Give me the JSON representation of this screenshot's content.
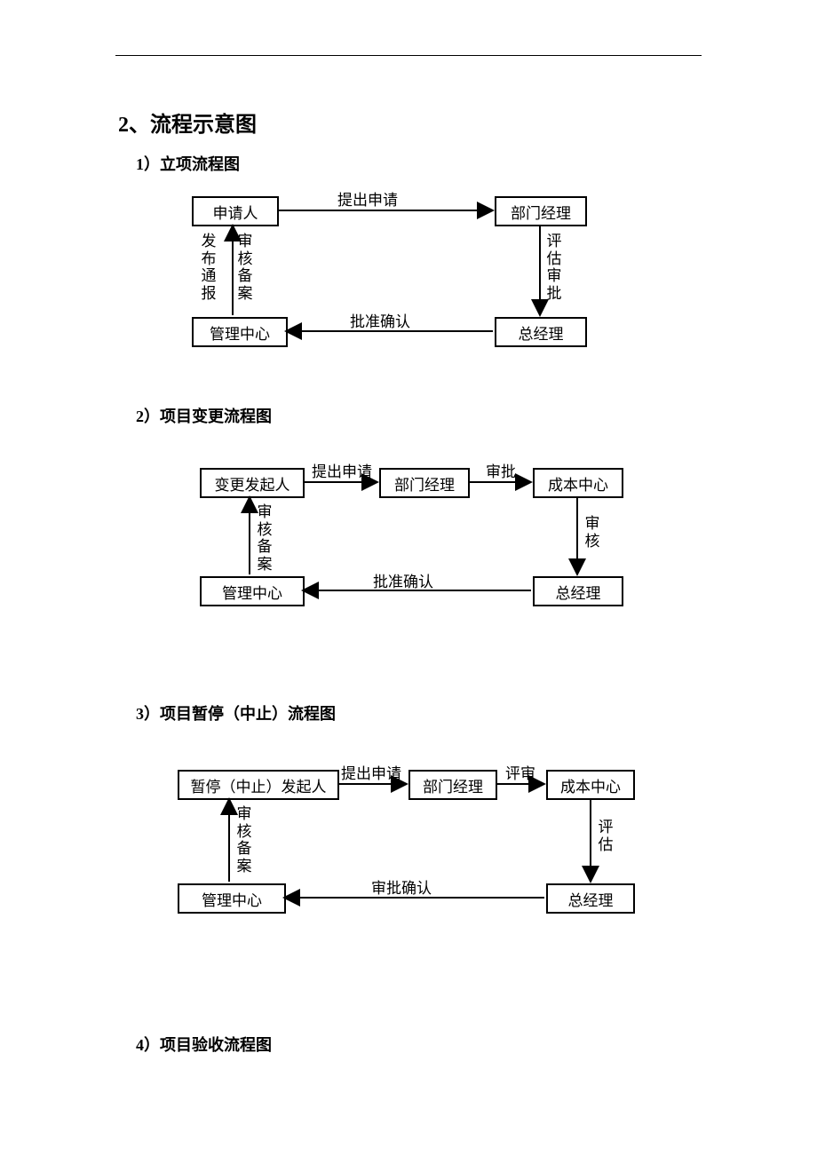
{
  "heading": "2、流程示意图",
  "section1": {
    "title": "1）立项流程图",
    "boxes": {
      "applicant": "申请人",
      "deptMgr": "部门经理",
      "gm": "总经理",
      "mgmtCenter": "管理中心"
    },
    "labels": {
      "submit": "提出申请",
      "evalApprove": "评估审批",
      "approveConfirm": "批准确认",
      "publish": "发布通报",
      "auditFile": "审核备案"
    }
  },
  "section2": {
    "title": "2）项目变更流程图",
    "boxes": {
      "initiator": "变更发起人",
      "deptMgr": "部门经理",
      "costCenter": "成本中心",
      "gm": "总经理",
      "mgmtCenter": "管理中心"
    },
    "labels": {
      "submit": "提出申请",
      "approve": "审批",
      "review": "审核",
      "approveConfirm": "批准确认",
      "auditFile": "审核备案"
    }
  },
  "section3": {
    "title": "3）项目暂停（中止）流程图",
    "boxes": {
      "initiator": "暂停（中止）发起人",
      "deptMgr": "部门经理",
      "costCenter": "成本中心",
      "gm": "总经理",
      "mgmtCenter": "管理中心"
    },
    "labels": {
      "submit": "提出申请",
      "review": "评审",
      "evaluate": "评估",
      "approveConfirm": "审批确认",
      "auditFile": "审核备案"
    }
  },
  "section4": {
    "title": "4）项目验收流程图"
  }
}
